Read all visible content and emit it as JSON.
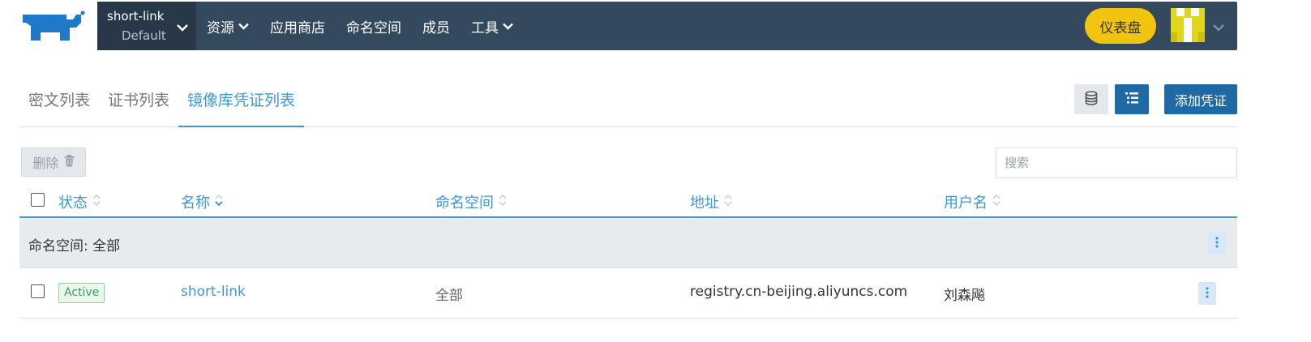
{
  "header": {
    "cluster_name": "short-link",
    "project_name": "Default",
    "nav": [
      {
        "label": "资源"
      },
      {
        "label": "应用商店"
      },
      {
        "label": "命名空间"
      },
      {
        "label": "成员"
      },
      {
        "label": "工具"
      }
    ],
    "dashboard_label": "仪表盘"
  },
  "tabs": [
    {
      "label": "密文列表"
    },
    {
      "label": "证书列表"
    },
    {
      "label": "镜像库凭证列表"
    }
  ],
  "toolbar": {
    "add_label": "添加凭证",
    "delete_label": "删除",
    "search_placeholder": "搜索"
  },
  "table": {
    "columns": [
      "状态",
      "名称",
      "命名空间",
      "地址",
      "用户名"
    ],
    "group_label": "命名空间: 全部",
    "rows": [
      {
        "status": "Active",
        "name": "short-link",
        "namespace": "全部",
        "address": "registry.cn-beijing.aliyuncs.com",
        "username": "刘森飚"
      }
    ]
  },
  "colors": {
    "topbar": "#35495e",
    "accent": "#3d98d3",
    "primary_button": "#1f6aa5",
    "dashboard_button": "#f1c40f",
    "active_badge": "#3f9d58"
  }
}
